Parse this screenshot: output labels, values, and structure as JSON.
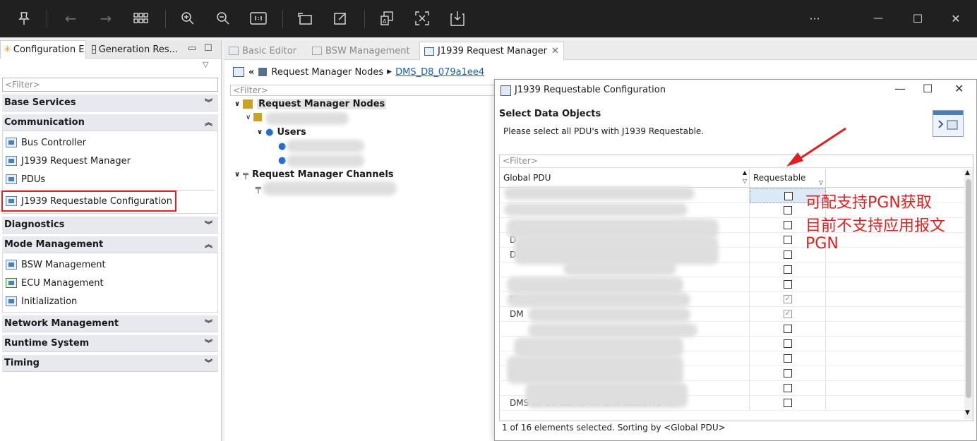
{
  "toolbar": {
    "icons": [
      "pin-icon",
      "back-icon",
      "forward-icon",
      "grid-icon",
      "zoom-in-icon",
      "zoom-out-icon",
      "fit-icon",
      "rotate-icon",
      "edit-icon",
      "translate-icon",
      "screenshot-icon",
      "save-icon",
      "more-icon",
      "minimize-icon",
      "maximize-icon",
      "close-icon"
    ],
    "more": "···",
    "minimize": "—",
    "maximize": "☐",
    "close": "✕"
  },
  "left_panel": {
    "tabs": [
      {
        "label": "Configuration E...",
        "active": true
      },
      {
        "label": "Generation Res...",
        "active": false
      }
    ],
    "filter_placeholder": "<Filter>",
    "sections": [
      {
        "label": "Base Services",
        "expanded": false
      },
      {
        "label": "Communication",
        "expanded": true,
        "items": [
          "Bus Controller",
          "J1939 Request Manager",
          "PDUs",
          "J1939 Requestable Configuration"
        ]
      },
      {
        "label": "Diagnostics",
        "expanded": false
      },
      {
        "label": "Mode Management",
        "expanded": true,
        "items": [
          "BSW Management",
          "ECU Management",
          "Initialization"
        ]
      },
      {
        "label": "Network Management",
        "expanded": false
      },
      {
        "label": "Runtime System",
        "expanded": false
      },
      {
        "label": "Timing",
        "expanded": false
      }
    ]
  },
  "editor": {
    "tabs": [
      {
        "label": "Basic Editor",
        "active": false
      },
      {
        "label": "BSW Management",
        "active": false
      },
      {
        "label": "J1939 Request Manager",
        "active": true
      }
    ],
    "breadcrumb": {
      "node": "Request Manager Nodes",
      "link": "DMS_D8_079a1ee4"
    },
    "filter_placeholder": "<Filter>",
    "tree": {
      "root": "Request Manager Nodes",
      "users": "Users",
      "channels": "Request Manager Channels"
    }
  },
  "dialog": {
    "title": "J1939 Requestable Configuration",
    "heading": "Select Data Objects",
    "subtitle": "Please select all PDU's with J1939 Requestable.",
    "filter_placeholder": "<Filter>",
    "columns": [
      "Global PDU",
      "Requestable"
    ],
    "rows": [
      {
        "pdu": "",
        "checked": false,
        "selected": true
      },
      {
        "pdu": "",
        "checked": false
      },
      {
        "pdu": "",
        "checked": false
      },
      {
        "pdu": "D",
        "checked": false
      },
      {
        "pdu": "DIAG3 ST DMS 19",
        "checked": false
      },
      {
        "pdu": "",
        "checked": false
      },
      {
        "pdu": "",
        "checked": false
      },
      {
        "pdu": "DM",
        "checked": true
      },
      {
        "pdu": "DM",
        "checked": true
      },
      {
        "pdu": "",
        "checked": false
      },
      {
        "pdu": "",
        "checked": false
      },
      {
        "pdu": "",
        "checked": false
      },
      {
        "pdu": "DM",
        "checked": false
      },
      {
        "pdu": "",
        "checked": false
      },
      {
        "pdu": "DMS 03 D8 DDMS 4U CAN dd3f87f1 Tx",
        "checked": false
      }
    ],
    "status": "1 of 16 elements selected. Sorting by <Global PDU>"
  },
  "annotation": {
    "line1": "可配支持PGN获取",
    "line2": "目前不支持应用报文",
    "line3": "PGN",
    "color": "#e21f1f"
  }
}
